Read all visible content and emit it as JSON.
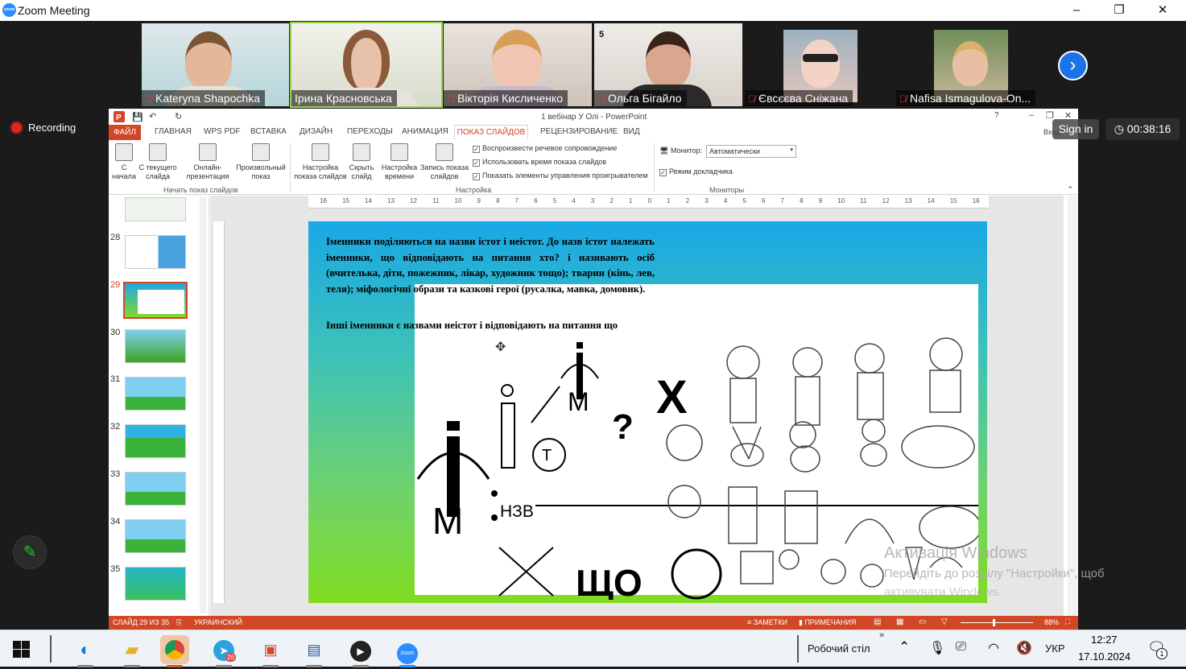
{
  "window": {
    "title": "Zoom Meeting",
    "logo_text": "zoom",
    "minimize": "–",
    "restore": "❐",
    "close": "✕"
  },
  "participants": [
    {
      "name": "Kateryna Shapochka"
    },
    {
      "name": "Ірина Красновська"
    },
    {
      "name": "Вікторія Кисличенко"
    },
    {
      "name": "Ольга Бігайло",
      "badge": "5"
    },
    {
      "name": "Євсєєва Сніжана"
    },
    {
      "name": "Nafisa Ismagulova-On..."
    }
  ],
  "meeting": {
    "recording": "Recording",
    "sign_in": "Sign in",
    "timer": "00:38:16",
    "next": "›",
    "pen": "✎"
  },
  "ppt": {
    "title": "1 вебінар У Олі - PowerPoint",
    "login": "Вход",
    "help": "?",
    "menus": [
      "ФАЙЛ",
      "ГЛАВНАЯ",
      "WPS PDF",
      "ВСТАВКА",
      "ДИЗАЙН",
      "ПЕРЕХОДЫ",
      "АНИМАЦИЯ",
      "ПОКАЗ СЛАЙДОВ",
      "РЕЦЕНЗИРОВАНИЕ",
      "ВИД"
    ],
    "ribbon": {
      "btn_start": "С начала",
      "btn_current": "С текущего слайда",
      "btn_online": "Онлайн-презентация",
      "btn_custom": "Произвольный показ",
      "group_start": "Начать показ слайдов",
      "btn_setup": "Настройка показа слайдов",
      "btn_hide": "Скрыть слайд",
      "btn_timing": "Настройка времени",
      "btn_record": "Запись показа слайдов",
      "chk1": "Воспроизвести речевое сопровождение",
      "chk2": "Использовать время показа слайдов",
      "chk3": "Показать элементы управления проигрывателем",
      "group_setup": "Настройка",
      "monitor_label": "Монитор:",
      "monitor_value": "Автоматически",
      "presenter": "Режим докладчика",
      "group_monitors": "Мониторы"
    },
    "thumbs": [
      "28",
      "29",
      "30",
      "31",
      "32",
      "33",
      "34",
      "35"
    ],
    "ruler": [
      "16",
      "15",
      "14",
      "13",
      "12",
      "11",
      "10",
      "9",
      "8",
      "7",
      "6",
      "5",
      "4",
      "3",
      "2",
      "1",
      "0",
      "1",
      "2",
      "3",
      "4",
      "5",
      "6",
      "7",
      "8",
      "9",
      "10",
      "11",
      "12",
      "13",
      "14",
      "15",
      "16"
    ],
    "slide": {
      "paragraph1": "Іменники поділяються на назви істот  і неістот. До назв істот належать іменники, що відповідають на питання хто? і називають осіб (вчителька, діти,  пожежник, лікар, художник тощо); тварин (кінь, лев, теля); міфологічні образи та казкові герої (русалка, мавка, домовик).",
      "paragraph2": "Інші іменники є назвами неістот і відповідають на питання що",
      "letter_i": "і",
      "letter_m": "М",
      "letter_t": "Т",
      "question": "?",
      "nzv": "НЗВ",
      "shcho": "ЩО",
      "cross": "Х"
    },
    "status": {
      "slide": "СЛАЙД 29 ИЗ 35",
      "lang": "УКРАИНСКИЙ",
      "notes": "ЗАМЕТКИ",
      "comments": "ПРИМЕЧАНИЯ",
      "zoom": "88%"
    }
  },
  "watermark": {
    "title": "Активація Windows",
    "line1": "Перейдіть до розділу \"Настройки\", щоб",
    "line2": "активувати Windows."
  },
  "taskbar": {
    "desktop": "Робочий стіл",
    "lang": "УКР",
    "time": "12:27",
    "date": "17.10.2024",
    "telegram_badge": "26",
    "notif_badge": "1"
  },
  "colors": {
    "accent": "#d24726",
    "zoom_blue": "#2d8cff",
    "mic_muted": "#e5393a",
    "recording": "#e02424"
  }
}
